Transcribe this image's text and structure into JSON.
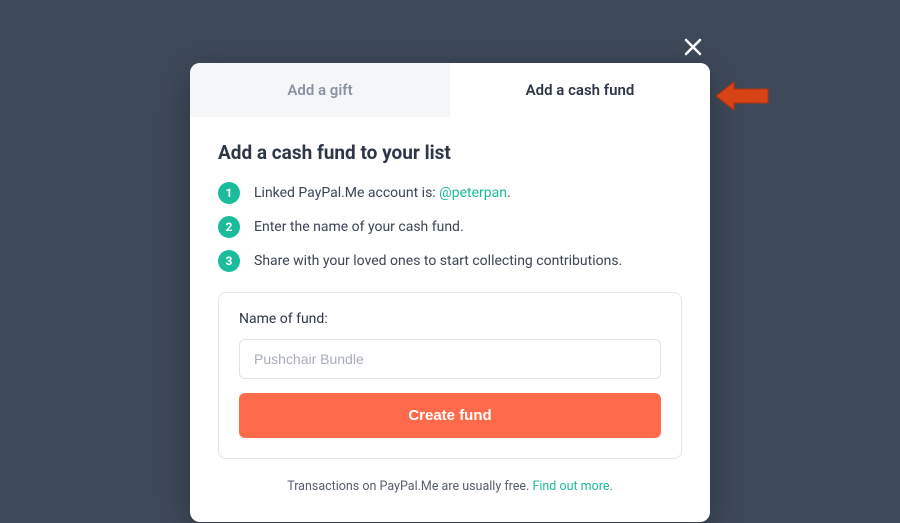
{
  "tabs": {
    "gift": "Add a gift",
    "cash": "Add a cash fund"
  },
  "heading": "Add a cash fund to your list",
  "steps": {
    "s1_prefix": "Linked PayPal.Me account is: ",
    "s1_handle": "@peterpan",
    "s1_suffix": ".",
    "s2": "Enter the name of your cash fund.",
    "s3": "Share with your loved ones to start collecting contributions."
  },
  "step_numbers": {
    "n1": "1",
    "n2": "2",
    "n3": "3"
  },
  "fund": {
    "label": "Name of fund:",
    "placeholder": "Pushchair Bundle",
    "button": "Create fund"
  },
  "footer": {
    "text": "Transactions on PayPal.Me are usually free. ",
    "link": "Find out more",
    "suffix": "."
  }
}
